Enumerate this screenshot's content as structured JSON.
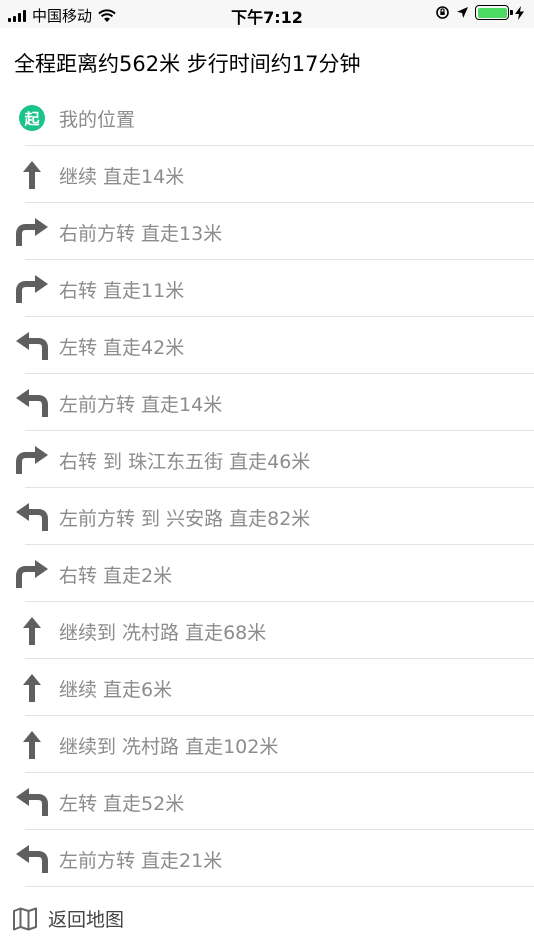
{
  "status_bar": {
    "carrier": "中国移动",
    "time": "下午7:12",
    "battery_color": "#4cd964"
  },
  "header": {
    "summary": "全程距离约562米 步行时间约17分钟"
  },
  "start": {
    "badge": "起",
    "label": "我的位置"
  },
  "steps": [
    {
      "icon": "straight",
      "text": "继续 直走14米"
    },
    {
      "icon": "right",
      "text": "右前方转 直走13米"
    },
    {
      "icon": "right",
      "text": "右转 直走11米"
    },
    {
      "icon": "left",
      "text": "左转 直走42米"
    },
    {
      "icon": "left",
      "text": "左前方转 直走14米"
    },
    {
      "icon": "right",
      "text": "右转 到 珠江东五街 直走46米"
    },
    {
      "icon": "left",
      "text": "左前方转 到 兴安路 直走82米"
    },
    {
      "icon": "right",
      "text": "右转 直走2米"
    },
    {
      "icon": "straight",
      "text": "继续到 冼村路 直走68米"
    },
    {
      "icon": "straight",
      "text": "继续 直走6米"
    },
    {
      "icon": "straight",
      "text": "继续到 冼村路 直走102米"
    },
    {
      "icon": "left",
      "text": "左转 直走52米"
    },
    {
      "icon": "left",
      "text": "左前方转 直走21米"
    }
  ],
  "footer": {
    "back_label": "返回地图",
    "back_icon": "map-icon"
  },
  "colors": {
    "icon_gray": "#5f5f5f",
    "start_green": "#1cc28c"
  }
}
